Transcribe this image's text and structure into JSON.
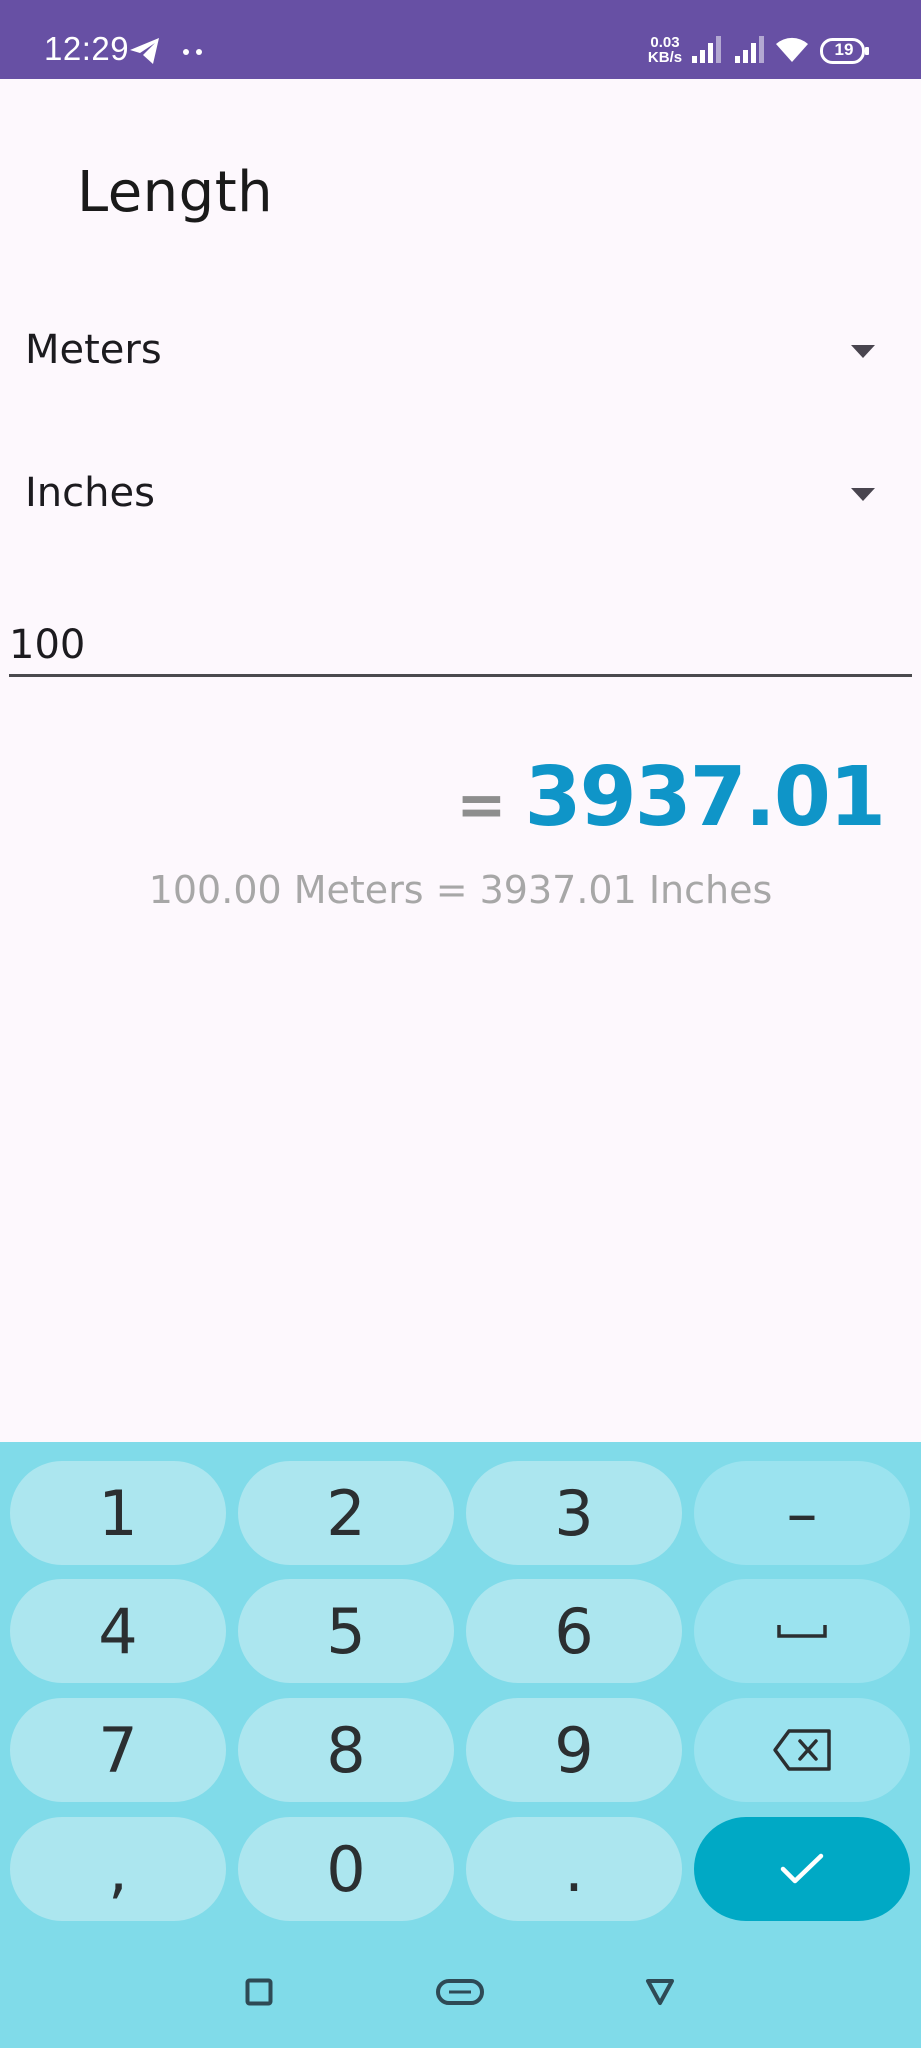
{
  "status_bar": {
    "time": "12:29",
    "net_speed_value": "0.03",
    "net_speed_unit": "KB/s",
    "battery": "19",
    "icons": [
      "telegram-icon",
      "more-dots-icon",
      "signal-icon",
      "signal-icon",
      "wifi-icon",
      "battery-icon"
    ]
  },
  "header": {
    "title": "Length"
  },
  "converter": {
    "from_unit": "Meters",
    "to_unit": "Inches",
    "input_value": "100",
    "result_equals": "=",
    "result_value": "3937.01",
    "summary": "100.00 Meters = 3937.01 Inches"
  },
  "keyboard": {
    "rows": [
      [
        "1",
        "2",
        "3",
        "–"
      ],
      [
        "4",
        "5",
        "6",
        ""
      ],
      [
        "7",
        "8",
        "9",
        ""
      ],
      [
        ",",
        "0",
        ".",
        ""
      ]
    ],
    "special_keys": {
      "space": "space-icon",
      "backspace": "backspace-icon",
      "enter": "checkmark-icon"
    }
  },
  "navigation": {
    "icons": [
      "recents-square-icon",
      "home-pill-icon",
      "back-triangle-icon"
    ]
  },
  "colors": {
    "status_bar": "#6750a4",
    "background": "#fdf8fd",
    "result_accent": "#0f95c8",
    "keyboard_bg": "#80dbe9",
    "key_bg": "#ace6ef",
    "enter_key": "#00a9c5"
  }
}
